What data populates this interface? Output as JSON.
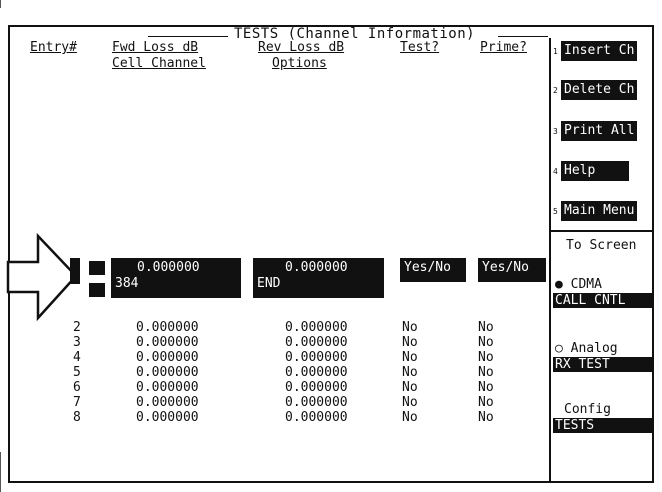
{
  "title": "TESTS (Channel Information)",
  "headers": {
    "entry": "Entry#",
    "fwd_loss": "Fwd Loss dB",
    "rev_loss": "Rev Loss dB",
    "test": "Test?",
    "prime": "Prime?",
    "cell_channel": "Cell Channel",
    "options": "Options"
  },
  "softkeys": [
    {
      "num": "1",
      "label": "Insert Ch"
    },
    {
      "num": "2",
      "label": "Delete Ch"
    },
    {
      "num": "3",
      "label": "Print All"
    },
    {
      "num": "4",
      "label": "Help"
    },
    {
      "num": "5",
      "label": "Main Menu"
    }
  ],
  "to_screen": {
    "heading": "To Screen",
    "cdma_radio": "●",
    "cdma": "CDMA",
    "cdma_btn": "CALL CNTL",
    "analog_radio": "○",
    "analog": "Analog",
    "analog_btn": "RX TEST",
    "config": "Config",
    "config_btn": "TESTS"
  },
  "current_entry": {
    "fwd_loss": "0.000000",
    "channel": "384",
    "rev_loss": "0.000000",
    "options": "END",
    "test": "Yes/No",
    "prime": "Yes/No"
  },
  "rows": [
    {
      "entry": "2",
      "fwd": "0.000000",
      "rev": "0.000000",
      "test": "No",
      "prime": "No"
    },
    {
      "entry": "3",
      "fwd": "0.000000",
      "rev": "0.000000",
      "test": "No",
      "prime": "No"
    },
    {
      "entry": "4",
      "fwd": "0.000000",
      "rev": "0.000000",
      "test": "No",
      "prime": "No"
    },
    {
      "entry": "5",
      "fwd": "0.000000",
      "rev": "0.000000",
      "test": "No",
      "prime": "No"
    },
    {
      "entry": "6",
      "fwd": "0.000000",
      "rev": "0.000000",
      "test": "No",
      "prime": "No"
    },
    {
      "entry": "7",
      "fwd": "0.000000",
      "rev": "0.000000",
      "test": "No",
      "prime": "No"
    },
    {
      "entry": "8",
      "fwd": "0.000000",
      "rev": "0.000000",
      "test": "No",
      "prime": "No"
    }
  ]
}
